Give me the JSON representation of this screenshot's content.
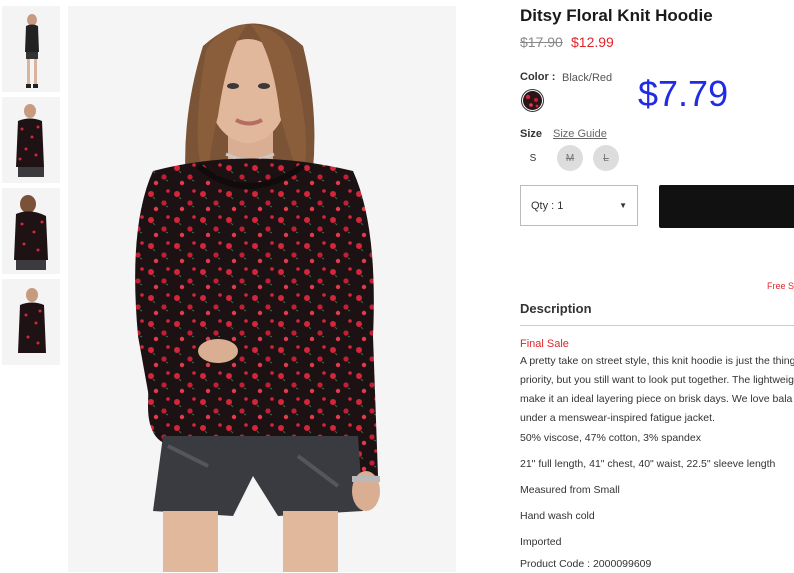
{
  "product": {
    "title": "Ditsy Floral Knit Hoodie",
    "price_original": "$17.90",
    "price_sale": "$12.99",
    "overlay_price": "$7.79"
  },
  "color": {
    "label": "Color :",
    "value": "Black/Red"
  },
  "size": {
    "label": "Size",
    "guide_link": "Size Guide",
    "options": [
      "S",
      "M",
      "L"
    ]
  },
  "quantity": {
    "label": "Qty : 1"
  },
  "free_shipping_text": "Free S",
  "description": {
    "heading": "Description",
    "final_sale": "Final Sale",
    "body_lines": [
      "A pretty take on street style, this knit hoodie is just the thing",
      "priority, but you still want to look put together. The lightweig",
      "make it an ideal layering piece on brisk days. We love bala",
      "under a menswear-inspired fatigue jacket."
    ],
    "content": "50% viscose, 47% cotton, 3% spandex",
    "measurements": "21\" full length, 41\" chest, 40\" waist, 22.5\" sleeve length",
    "measured_from": "Measured from Small",
    "care": "Hand wash cold",
    "origin": "Imported",
    "product_code": "Product Code : 2000099609"
  },
  "colors": {
    "sale_red": "#e0262b",
    "overlay_blue": "#1f2be6",
    "button_black": "#111111"
  }
}
